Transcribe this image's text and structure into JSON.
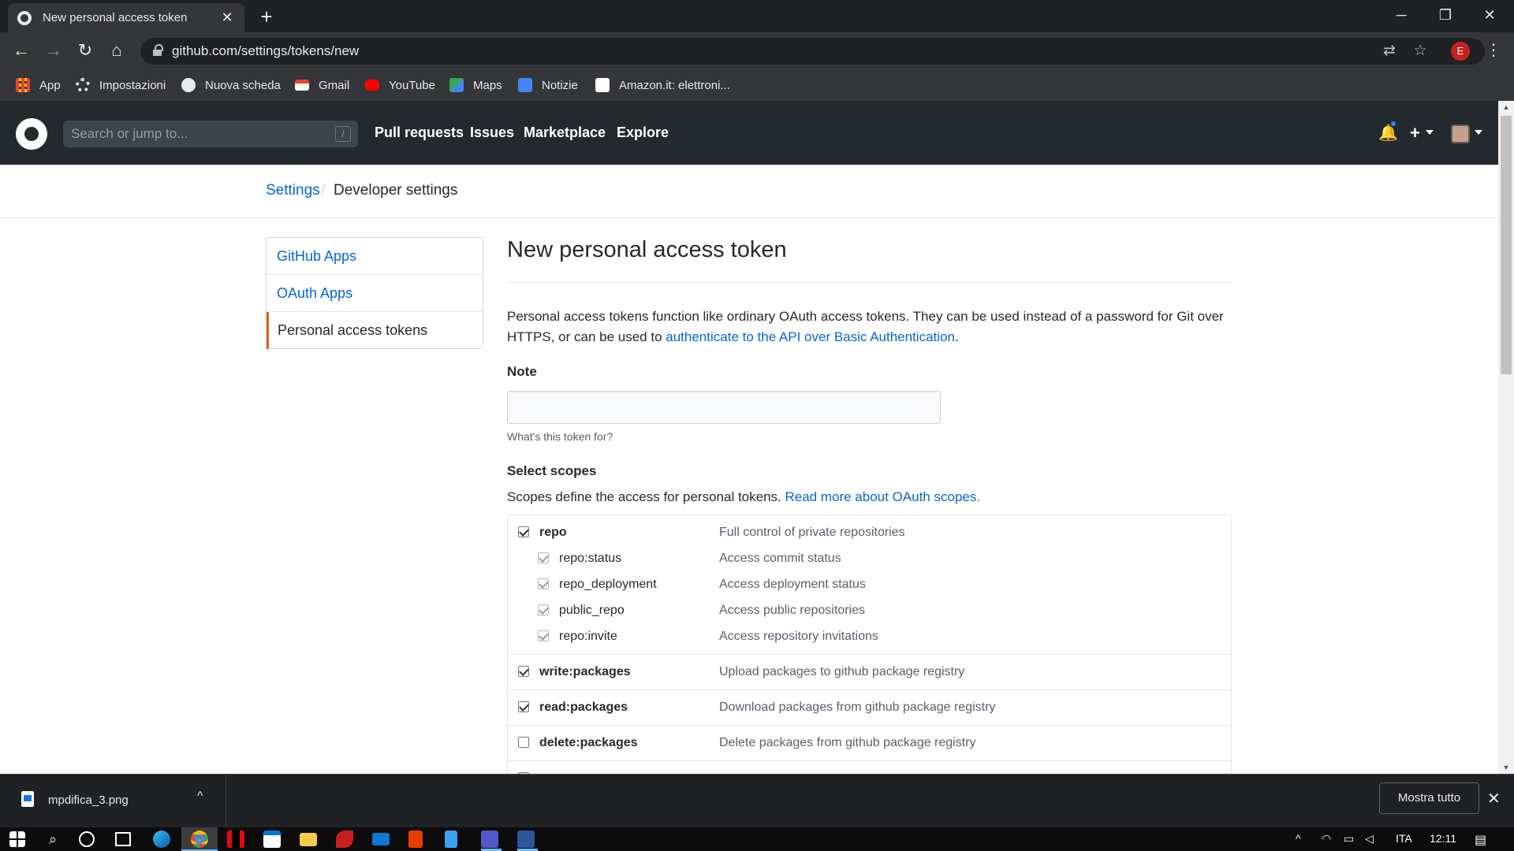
{
  "browser": {
    "tab_title": "New personal access token",
    "tab_close": "✕",
    "new_tab": "+",
    "url": "github.com/settings/tokens/new",
    "profile_initial": "E",
    "window_controls": {
      "minimize": "─",
      "restore": "❐",
      "close": "✕"
    },
    "nav_glyphs": {
      "back": "←",
      "forward": "→",
      "reload": "↻",
      "home": "⌂",
      "translate": "⇄",
      "star": "☆",
      "menu": "⋮"
    },
    "bookmarks": [
      {
        "label": "App",
        "icon": "apps-grid-icon",
        "color": "#ea4335"
      },
      {
        "label": "Impostazioni",
        "icon": "gear-icon",
        "color": "#e8eaed"
      },
      {
        "label": "Nuova scheda",
        "icon": "globe-icon",
        "color": "#e8eaed"
      },
      {
        "label": "Gmail",
        "icon": "gmail-icon",
        "color": "#ea4335"
      },
      {
        "label": "YouTube",
        "icon": "youtube-icon",
        "color": "#ff0000"
      },
      {
        "label": "Maps",
        "icon": "maps-pin-icon",
        "color": "#34a853"
      },
      {
        "label": "Notizie",
        "icon": "news-icon",
        "color": "#4285f4"
      },
      {
        "label": "Amazon.it: elettroni...",
        "icon": "amazon-icon",
        "color": "#ffffff"
      }
    ]
  },
  "github": {
    "search_placeholder": "Search or jump to...",
    "search_shortcut": "/",
    "nav": [
      "Pull requests",
      "Issues",
      "Marketplace",
      "Explore"
    ],
    "plus": "+",
    "bell": "🔔",
    "accent_blue": "#0366d6",
    "header_bg": "#24292e"
  },
  "breadcrumb": {
    "parent": "Settings",
    "separator": "/",
    "current": "Developer settings"
  },
  "sidebar": {
    "items": [
      {
        "label": "GitHub Apps"
      },
      {
        "label": "OAuth Apps"
      },
      {
        "label": "Personal access tokens"
      }
    ]
  },
  "main": {
    "title": "New personal access token",
    "description_before": "Personal access tokens function like ordinary OAuth access tokens. They can be used instead of a password for Git over HTTPS, or can be used to ",
    "description_link": "authenticate to the API over Basic Authentication",
    "description_after": ".",
    "note_label": "Note",
    "note_value": "",
    "note_hint": "What's this token for?",
    "scopes_title": "Select scopes",
    "scopes_desc": "Scopes define the access for personal tokens. ",
    "scopes_link": "Read more about OAuth scopes."
  },
  "scopes": {
    "repo": {
      "name": "repo",
      "desc": "Full control of private repositories",
      "checked": true
    },
    "repo_status": {
      "name": "repo:status",
      "desc": "Access commit status",
      "checked": true
    },
    "repo_deployment": {
      "name": "repo_deployment",
      "desc": "Access deployment status",
      "checked": true
    },
    "public_repo": {
      "name": "public_repo",
      "desc": "Access public repositories",
      "checked": true
    },
    "repo_invite": {
      "name": "repo:invite",
      "desc": "Access repository invitations",
      "checked": true
    },
    "write_packages": {
      "name": "write:packages",
      "desc": "Upload packages to github package registry",
      "checked": true
    },
    "read_packages": {
      "name": "read:packages",
      "desc": "Download packages from github package registry",
      "checked": true
    },
    "delete_packages": {
      "name": "delete:packages",
      "desc": "Delete packages from github package registry",
      "checked": false
    }
  },
  "download_bar": {
    "file_name": "mpdifica_3.png",
    "chevron": "^",
    "show_all": "Mostra tutto",
    "close": "✕"
  },
  "taskbar": {
    "language": "ITA",
    "time": "12:11",
    "pinned": [
      "windows-start-icon",
      "search-icon",
      "cortana-icon",
      "task-view-icon",
      "edge-icon",
      "chrome-icon",
      "netflix-icon",
      "store-icon",
      "file-explorer-icon",
      "app-icon",
      "mail-icon",
      "office-icon",
      "notepad-icon",
      "teams-icon",
      "word-icon"
    ]
  }
}
